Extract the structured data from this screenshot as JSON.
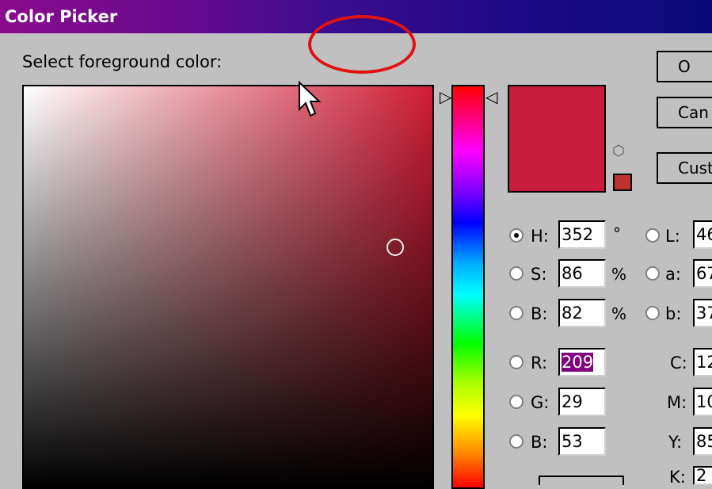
{
  "window": {
    "title": "Color Picker"
  },
  "prompt": "Select foreground color:",
  "buttons": {
    "ok": "O",
    "cancel": "Can",
    "custom": "Cust"
  },
  "colors": {
    "current": "#c71d3b",
    "gamut": "#bf3232"
  },
  "hsb": {
    "h_label": "H:",
    "h_value": "352",
    "h_unit": "°",
    "s_label": "S:",
    "s_value": "86",
    "s_unit": "%",
    "b_label": "B:",
    "b_value": "82",
    "b_unit": "%"
  },
  "rgb": {
    "r_label": "R:",
    "r_value": "209",
    "g_label": "G:",
    "g_value": "29",
    "b_label": "B:",
    "b_value": "53"
  },
  "lab": {
    "l_label": "L:",
    "l_value": "46",
    "a_label": "a:",
    "a_value": "67",
    "b_label": "b:",
    "b_value": "37"
  },
  "cmyk": {
    "c_label": "C:",
    "c_value": "12",
    "m_label": "M:",
    "m_value": "10",
    "y_label": "Y:",
    "y_value": "85",
    "k_label": "K:",
    "k_value": "2"
  },
  "icons": [
    "cursor-arrow-icon",
    "gamut-warning-icon",
    "hue-slider-arrow-icon"
  ]
}
